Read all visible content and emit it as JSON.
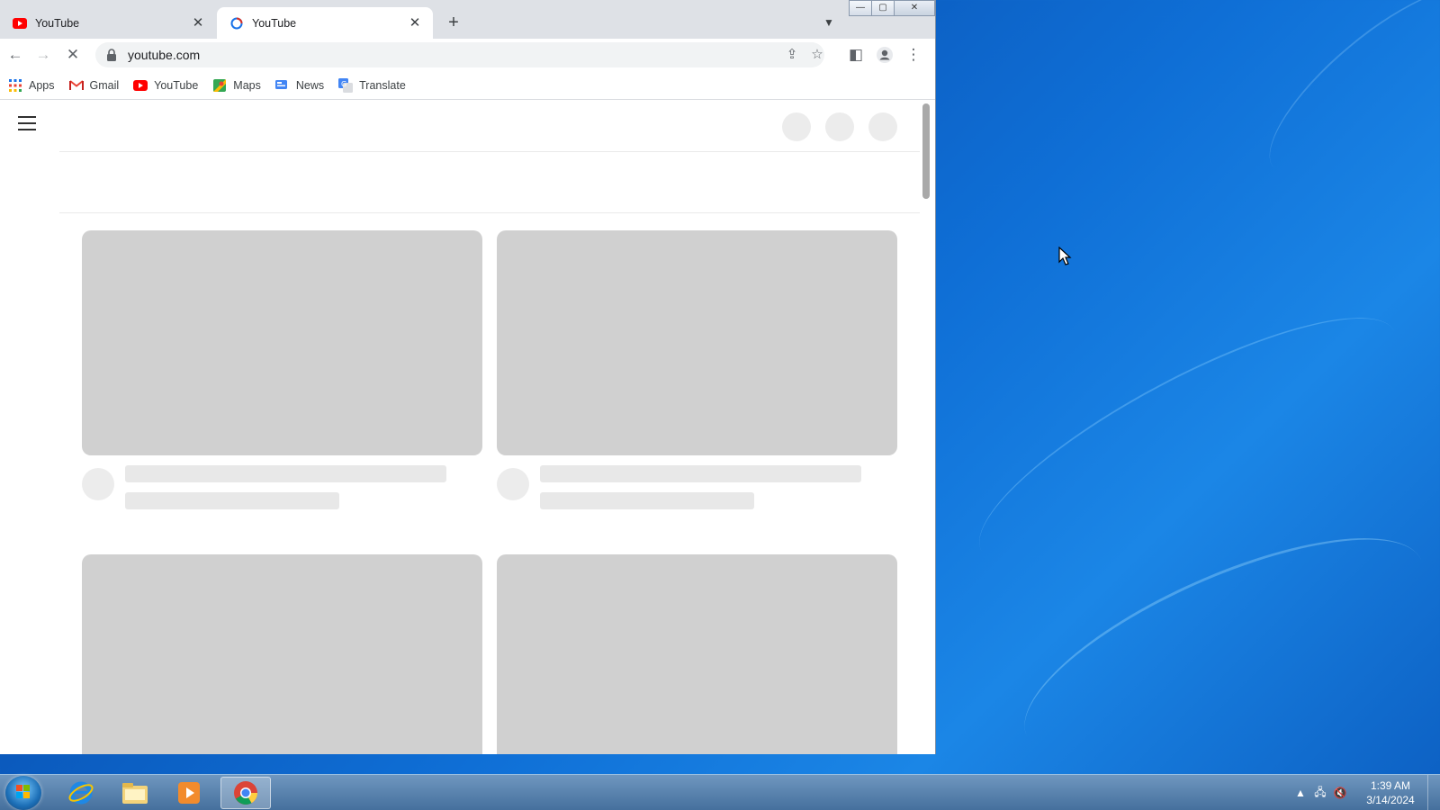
{
  "browser": {
    "tabs": [
      {
        "label": "YouTube",
        "active": false
      },
      {
        "label": "YouTube",
        "active": true
      }
    ],
    "new_tab_symbol": "+",
    "address": "youtube.com",
    "bookmarks": [
      {
        "label": "Apps",
        "icon": "apps-grid-icon"
      },
      {
        "label": "Gmail",
        "icon": "gmail-icon"
      },
      {
        "label": "YouTube",
        "icon": "youtube-icon"
      },
      {
        "label": "Maps",
        "icon": "maps-icon"
      },
      {
        "label": "News",
        "icon": "news-icon"
      },
      {
        "label": "Translate",
        "icon": "translate-icon"
      }
    ]
  },
  "taskbar": {
    "time": "1:39 AM",
    "date": "3/14/2024",
    "apps": [
      "internet-explorer-icon",
      "file-explorer-icon",
      "media-player-icon",
      "chrome-icon"
    ]
  },
  "colors": {
    "youtube_red": "#ff0000",
    "skeleton": "#d0d0d0",
    "desktop_blue": "#0f6fd6"
  }
}
